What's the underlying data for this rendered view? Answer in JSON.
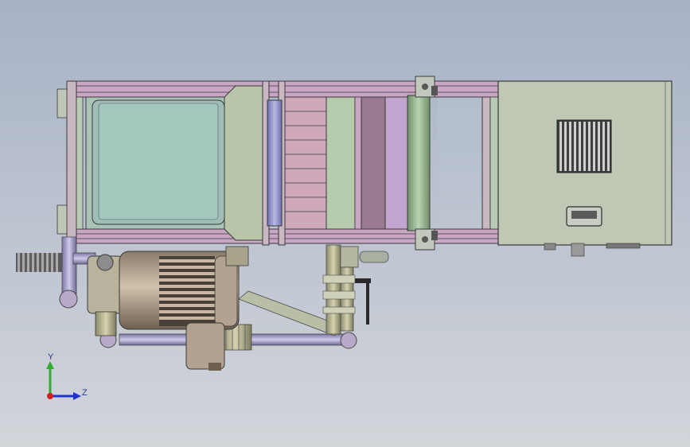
{
  "viewport": {
    "background_top": "#a7b2c6",
    "background_bottom": "#d2d5da"
  },
  "triad": {
    "y_label": "Y",
    "z_label": "Z",
    "y_color": "#2fae2f",
    "z_color": "#2233cc",
    "origin_color": "#d02020"
  },
  "model": {
    "frame_color": "#c79fc0",
    "cabinet_color": "#bfc8b4",
    "tank_color": "#a9c4b6",
    "motor_color": "#b3a28f",
    "pipe_color": "#a7a1c8"
  }
}
